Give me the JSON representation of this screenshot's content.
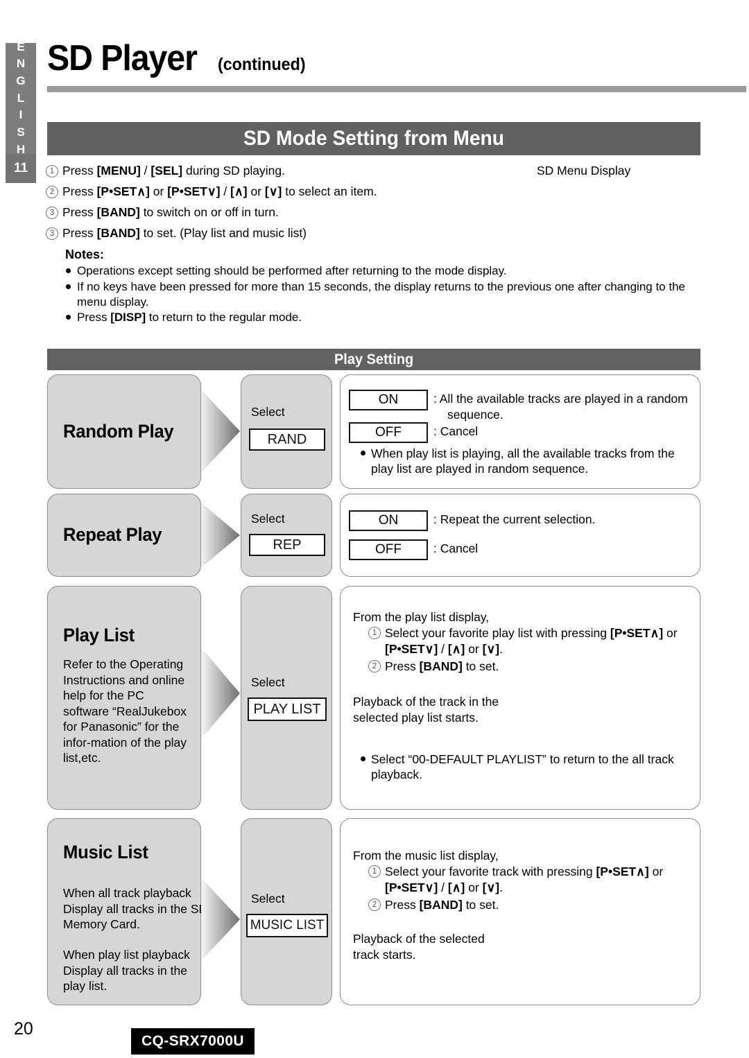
{
  "sidebar": {
    "language_letters": [
      "E",
      "N",
      "G",
      "L",
      "I",
      "S",
      "H"
    ],
    "chapter_number": "11"
  },
  "header": {
    "title": "SD Player",
    "title_suffix": "(continued)",
    "section_banner": "SD Mode Setting from Menu"
  },
  "steps": [
    {
      "num": "1",
      "html": "Press <b>[MENU] / [SEL]</b> during SD playing."
    },
    {
      "num": "2",
      "html": "Press <b>[P•SET∧]</b> or <b>[P•SET∨] / [∧]</b> or <b>[∨]</b> to select an item."
    },
    {
      "num": "3",
      "html": "Press <b>[BAND]</b> to switch on or off in turn."
    },
    {
      "num": "3",
      "html": "Press <b>[BAND]</b> to set. (Play list and music list)"
    }
  ],
  "steps_plain": [
    "Press [MENU] / [SEL] during SD playing.",
    "Press [P•SET∧] or [P•SET∨] / [∧] or [∨] to select an item.",
    "Press [BAND] to switch on or off in turn.",
    "Press [BAND] to set. (Play list and music list)"
  ],
  "sd_menu_display_label": "SD Menu Display",
  "notes": {
    "title": "Notes:",
    "items": [
      "Operations except setting should be performed after returning to the mode display.",
      "If no keys have been pressed for more than 15 seconds, the display returns to the previous one after changing to the menu display.",
      "Press [DISP] to return to the regular mode."
    ]
  },
  "play_setting": {
    "banner": "Play Setting",
    "select_label": "Select",
    "rows": [
      {
        "title": "Random Play",
        "tag": "RAND",
        "options": [
          {
            "label": "ON",
            "desc_line1": ": All the available tracks are played in a random",
            "desc_line2": "sequence."
          },
          {
            "label": "OFF",
            "desc_line1": ": Cancel",
            "desc_line2": ""
          }
        ],
        "bullet": "When play list is playing, all the available tracks from the play list are played in random sequence."
      },
      {
        "title": "Repeat Play",
        "tag": "REP",
        "options": [
          {
            "label": "ON",
            "desc_line1": ": Repeat the current selection.",
            "desc_line2": ""
          },
          {
            "label": "OFF",
            "desc_line1": ": Cancel",
            "desc_line2": ""
          }
        ],
        "bullet": ""
      },
      {
        "title": "Play List",
        "tag": "PLAY LIST",
        "body": "Refer to the Operating Instructions and online help for the PC software “RealJukebox for Panasonic” for the infor-mation of the play list,etc.",
        "desc_intro": "From the play list display,",
        "desc_step1_a": "Select your favorite play list with pressing [P•SET∧] or",
        "desc_step1_b": "[P•SET∨] / [∧] or [∨].",
        "desc_step2": "Press [BAND] to set.",
        "desc_result": "Playback of the track in the selected play list starts.",
        "desc_bullet": "Select “00-DEFAULT PLAYLIST” to return to the all track playback."
      },
      {
        "title": "Music List",
        "tag": "MUSIC LIST",
        "body_a": "When all track playback Display all tracks in the SD Memory Card.",
        "body_b": "When play list playback Display all tracks in the play list.",
        "desc_intro": "From the music list display,",
        "desc_step1_a": "Select your favorite track with pressing [P•SET∧] or",
        "desc_step1_b": "[P•SET∨] / [∧] or [∨].",
        "desc_step2": "Press [BAND] to set.",
        "desc_result": "Playback of the selected track starts."
      }
    ]
  },
  "footer": {
    "page_number": "20",
    "model": "CQ-SRX7000U"
  },
  "colors": {
    "banner_gray": "#616161",
    "box_gray": "#d6d6d6",
    "border_gray": "#8c8c8c",
    "tab_gray": "#7d7d7d"
  }
}
